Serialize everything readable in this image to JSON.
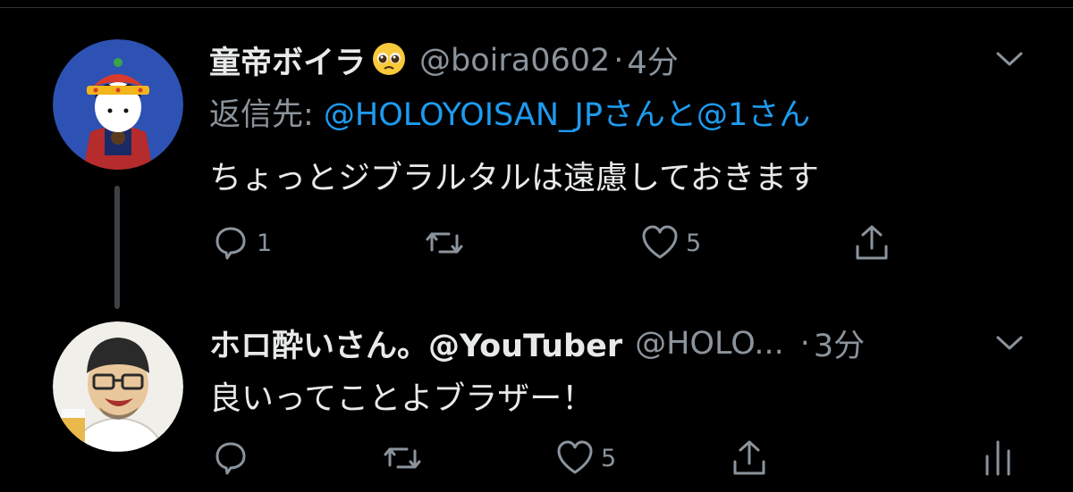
{
  "tweet1": {
    "display_name": "童帝ボイラ",
    "emoji_icon": "pleading-face-emoji",
    "handle": "@boira0602",
    "separator": "·",
    "time": "4分",
    "reply_label": "返信先: ",
    "reply_to": "@HOLOYOISAN_JPさんと@1さん",
    "text": "ちょっとジブラルタルは遠慮しておきます",
    "reply_count": "1",
    "like_count": "5"
  },
  "tweet2": {
    "display_name": "ホロ酔いさん。@YouTuber",
    "handle": "@HOLO...",
    "separator": "·",
    "time": "3分",
    "text": "良いってことよブラザー！",
    "like_count": "5"
  },
  "colors": {
    "background": "#000000",
    "primary_text": "#e7e9ea",
    "secondary_text": "#8b949c",
    "link": "#1d9bf0",
    "thread_line": "#3d4145"
  }
}
